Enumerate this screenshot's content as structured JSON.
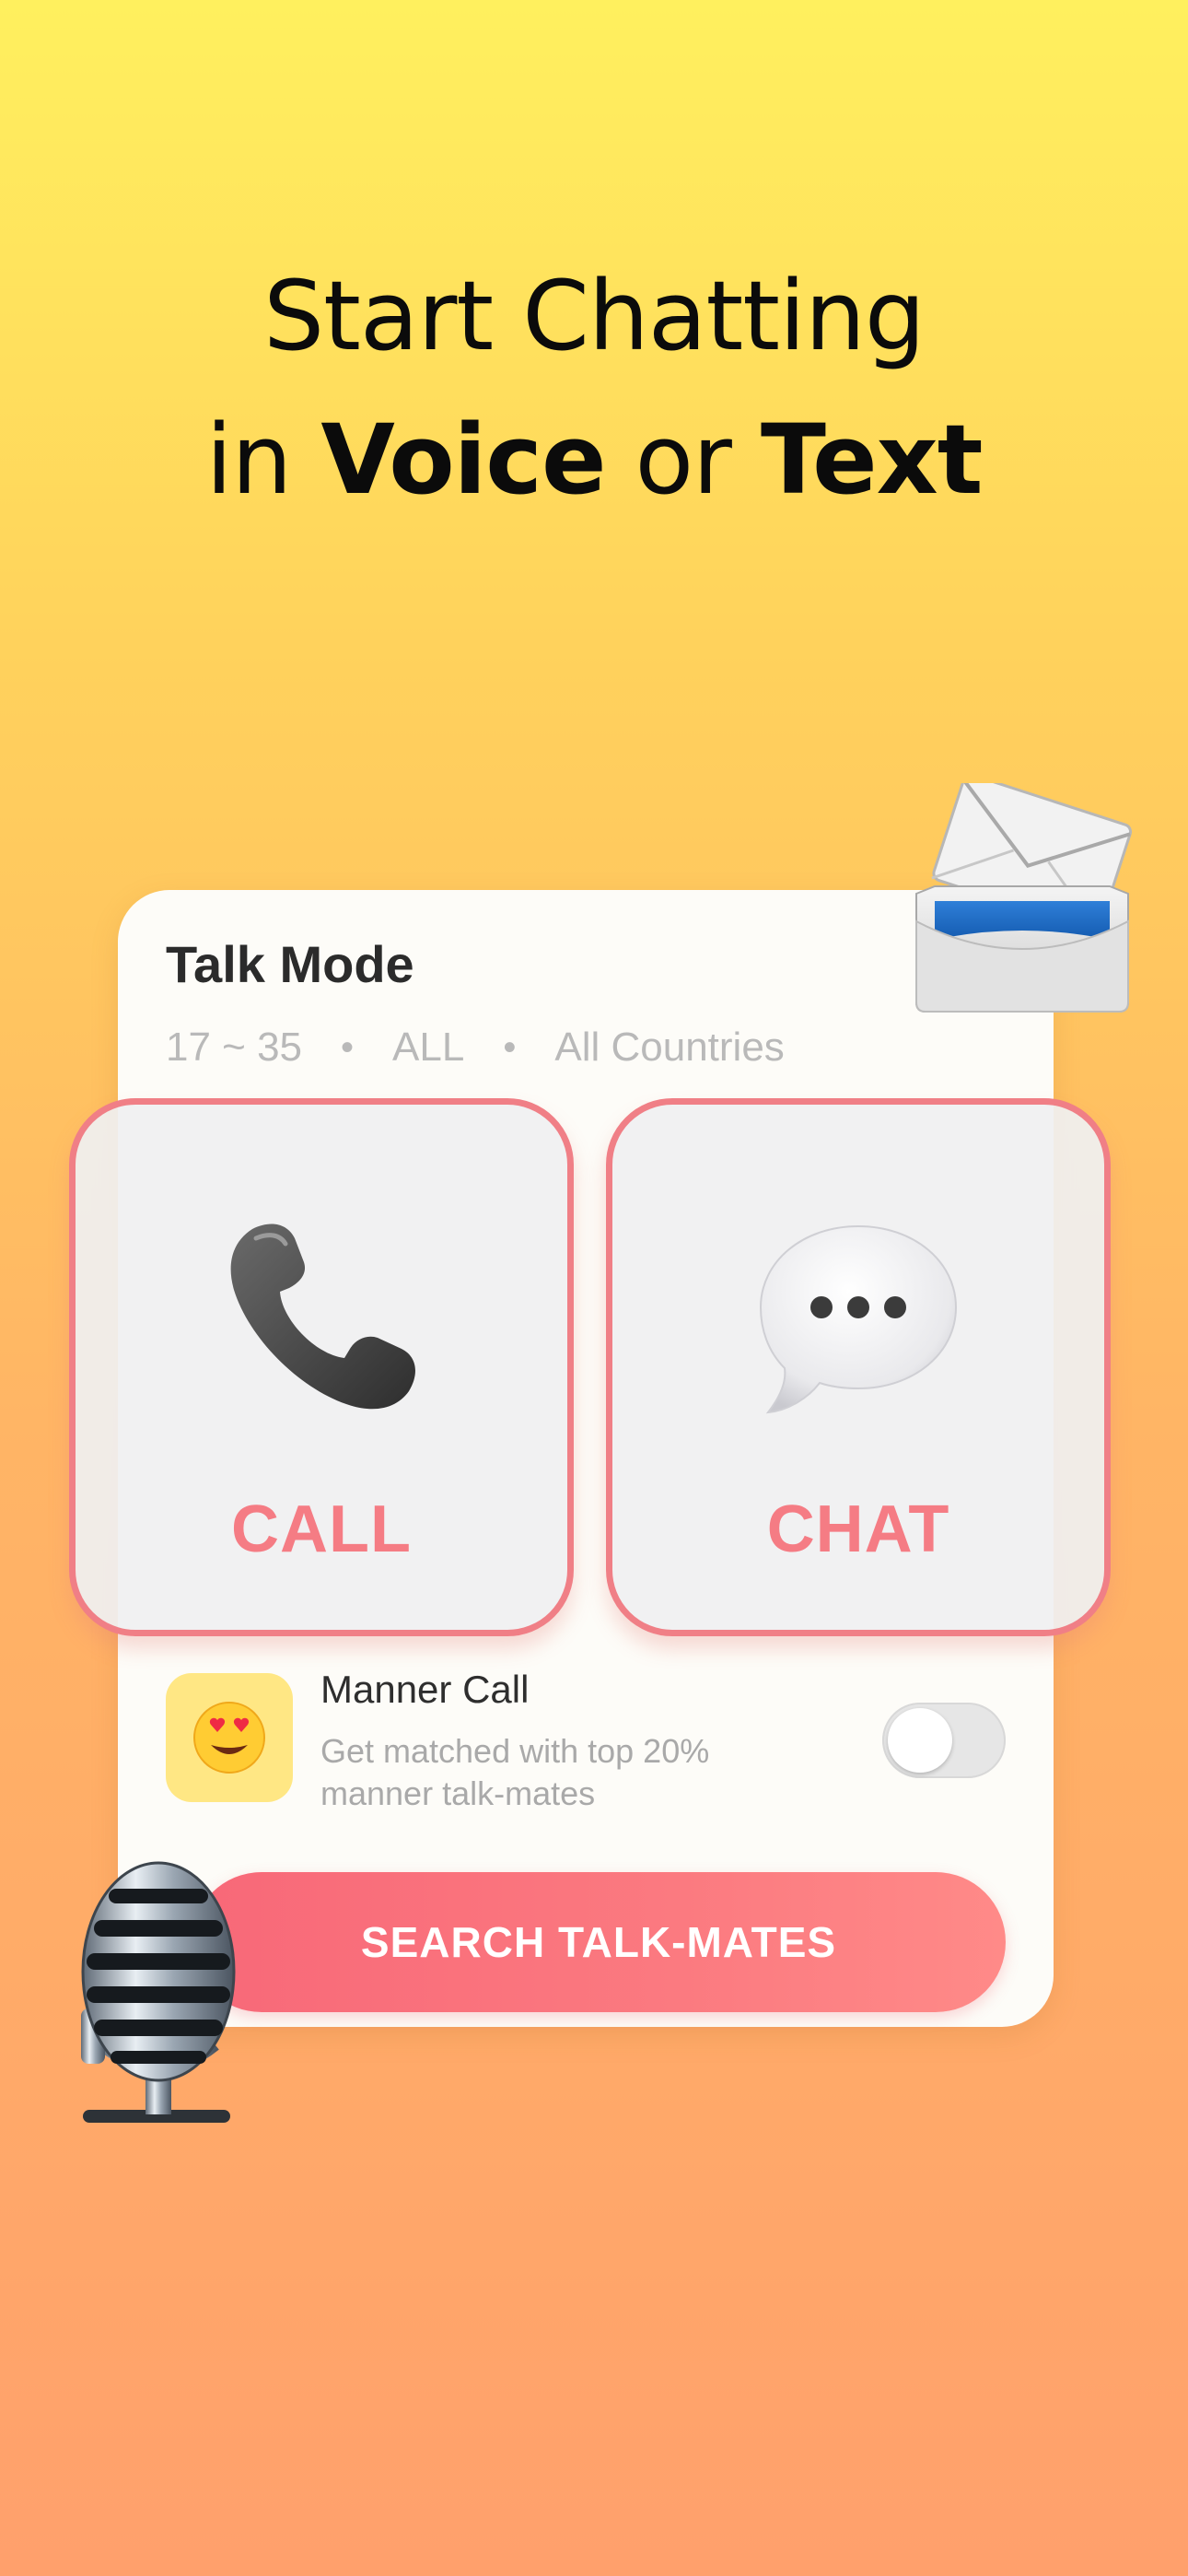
{
  "headline": {
    "line1": "Start Chatting",
    "line2_prefix": "in ",
    "line2_voice": "Voice",
    "line2_mid": " or ",
    "line2_text": "Text"
  },
  "card": {
    "title": "Talk Mode",
    "filters": {
      "age": "17 ~ 35",
      "gender": "ALL",
      "country": "All Countries",
      "separator": "•"
    },
    "modes": [
      {
        "label": "CALL",
        "icon": "telephone-receiver-icon"
      },
      {
        "label": "CHAT",
        "icon": "speech-bubble-icon"
      }
    ],
    "manner": {
      "icon": "heart-eyes-emoji-icon",
      "title": "Manner Call",
      "description": "Get matched with top 20% manner talk-mates",
      "toggle_on": false
    },
    "search_button": "SEARCH TALK-MATES"
  },
  "decorations": [
    "envelope-tray-icon",
    "microphone-icon"
  ],
  "colors": {
    "accent": "#f57c84",
    "button_gradient_start": "#f86878",
    "background_top": "#fff05e",
    "background_bottom": "#ffa06c"
  }
}
